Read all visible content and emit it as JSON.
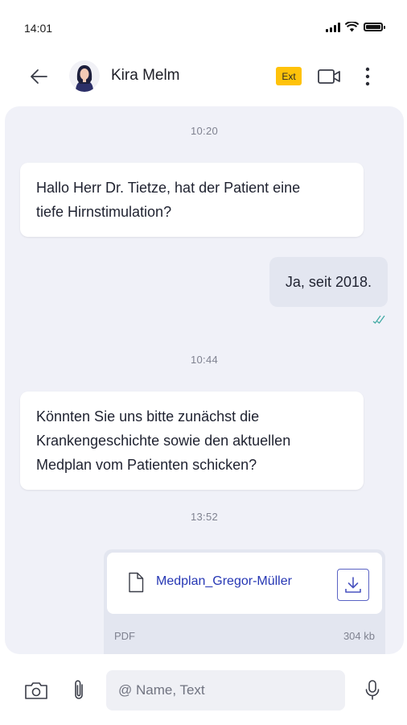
{
  "status_bar": {
    "time": "14:01"
  },
  "header": {
    "contact_name": "Kira Melm",
    "badge": "Ext",
    "icons": [
      "back-arrow-icon",
      "video-camera-icon",
      "more-vertical-icon"
    ]
  },
  "messages": [
    {
      "type": "time",
      "text": "10:20"
    },
    {
      "type": "incoming",
      "lines": [
        "Hallo Herr Dr. Tietze, hat der Patient eine",
        "tiefe Hirnstimulation?"
      ]
    },
    {
      "type": "outgoing",
      "text": "Ja, seit 2018.",
      "status": "read"
    },
    {
      "type": "time",
      "text": "10:44"
    },
    {
      "type": "incoming",
      "lines": [
        "Könnten Sie uns bitte zunächst die",
        "Krankengeschichte sowie den aktuellen",
        "Medplan vom Patienten schicken?"
      ]
    },
    {
      "type": "time",
      "text": "13:52"
    }
  ],
  "file_message": {
    "name": "Medplan_Gregor-Müller",
    "file_type": "PDF",
    "size": "304 kb"
  },
  "input": {
    "placeholder": "@ Name, Text",
    "value": ""
  },
  "colors": {
    "chat_bg": "#f0f1f8",
    "outgoing_bubble": "#e3e6f0",
    "badge": "#ffc20a",
    "link": "#2637b4",
    "read_check": "#3aa7a0"
  }
}
